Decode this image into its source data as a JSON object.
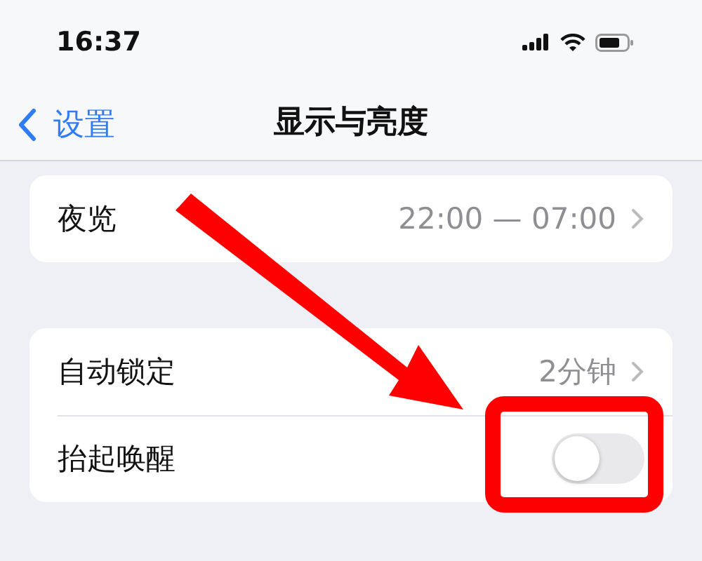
{
  "status_bar": {
    "time": "16:37"
  },
  "nav_bar": {
    "back_label": "设置",
    "title": "显示与亮度"
  },
  "groups": [
    {
      "rows": [
        {
          "kind": "detail",
          "label": "夜览",
          "value": "22:00 — 07:00"
        }
      ]
    },
    {
      "rows": [
        {
          "kind": "detail",
          "label": "自动锁定",
          "value": "2分钟"
        },
        {
          "kind": "toggle",
          "label": "抬起唤醒",
          "on": false
        }
      ]
    }
  ]
}
